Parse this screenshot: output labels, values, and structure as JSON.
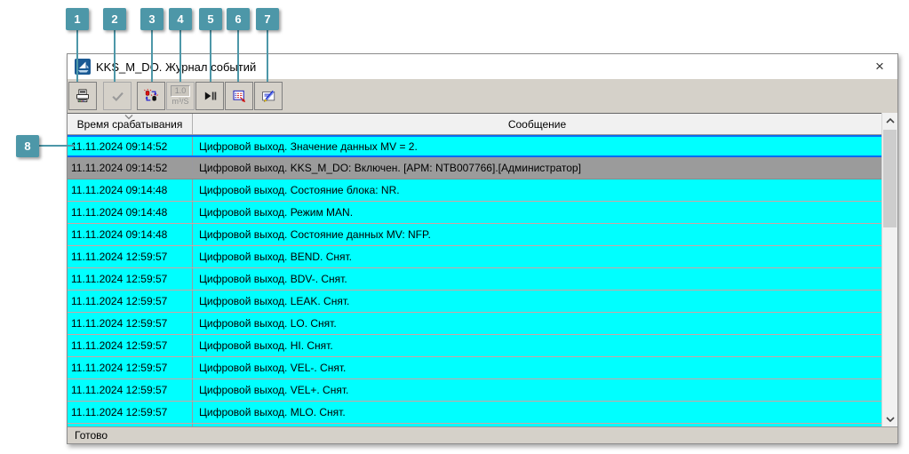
{
  "callouts": {
    "items": [
      "1",
      "2",
      "3",
      "4",
      "5",
      "6",
      "7",
      "8"
    ]
  },
  "window": {
    "title": "KKS_M_DO. Журнал событий",
    "app_icon": "sail-logo-icon",
    "close_glyph": "×",
    "toolbar": {
      "buttons": [
        {
          "icon": "printer-icon",
          "action": "print",
          "enabled": true
        },
        {
          "icon": "checkmark-icon",
          "action": "acknowledge",
          "enabled": false
        },
        {
          "icon": "alarm-blink-icon",
          "action": "toggle-blink",
          "enabled": true
        },
        {
          "icon": "units-icon",
          "action": "units",
          "enabled": false,
          "text_top": "1.0",
          "text_bottom": "m³/S"
        },
        {
          "icon": "play-pause-icon",
          "action": "pause-resume",
          "enabled": true
        },
        {
          "icon": "list-export-icon",
          "action": "event-list",
          "enabled": true
        },
        {
          "icon": "note-edit-icon",
          "action": "edit-note",
          "enabled": true
        }
      ]
    },
    "table": {
      "columns": [
        "Время срабатывания",
        "Сообщение"
      ],
      "sort_column": 0,
      "rows": [
        {
          "time": "11.11.2024 09:14:52",
          "message": "Цифровой выход. Значение данных MV = 2.",
          "state": "focused"
        },
        {
          "time": "11.11.2024 09:14:52",
          "message": "Цифровой выход. KKS_M_DO: Включен. [АРМ: NTB007766].[Администратор]",
          "state": "selected"
        },
        {
          "time": "11.11.2024 09:14:48",
          "message": "Цифровой выход. Состояние блока: NR.",
          "state": "normal"
        },
        {
          "time": "11.11.2024 09:14:48",
          "message": "Цифровой выход. Режим MAN.",
          "state": "normal"
        },
        {
          "time": "11.11.2024 09:14:48",
          "message": "Цифровой выход. Состояние данных MV: NFP.",
          "state": "normal"
        },
        {
          "time": "11.11.2024 12:59:57",
          "message": "Цифровой выход. BEND. Снят.",
          "state": "normal"
        },
        {
          "time": "11.11.2024 12:59:57",
          "message": "Цифровой выход. BDV-. Снят.",
          "state": "normal"
        },
        {
          "time": "11.11.2024 12:59:57",
          "message": "Цифровой выход. LEAK. Снят.",
          "state": "normal"
        },
        {
          "time": "11.11.2024 12:59:57",
          "message": "Цифровой выход. LO. Снят.",
          "state": "normal"
        },
        {
          "time": "11.11.2024 12:59:57",
          "message": "Цифровой выход. HI. Снят.",
          "state": "normal"
        },
        {
          "time": "11.11.2024 12:59:57",
          "message": "Цифровой выход. VEL-. Снят.",
          "state": "normal"
        },
        {
          "time": "11.11.2024 12:59:57",
          "message": "Цифровой выход. VEL+. Снят.",
          "state": "normal"
        },
        {
          "time": "11.11.2024 12:59:57",
          "message": "Цифровой выход. MLO. Снят.",
          "state": "normal"
        }
      ]
    },
    "status_bar": {
      "text": "Готово"
    }
  },
  "colors": {
    "badge": "#4d97a8",
    "rowCyan": "#00ffff",
    "rowSelected": "#9b9b9b",
    "focusBlue": "#0a6cf0",
    "chrome": "#d5d1c9",
    "headerBg": "#f1f1f1",
    "rowSep": "#cfa3a3",
    "colSep": "#9a9aa0"
  }
}
